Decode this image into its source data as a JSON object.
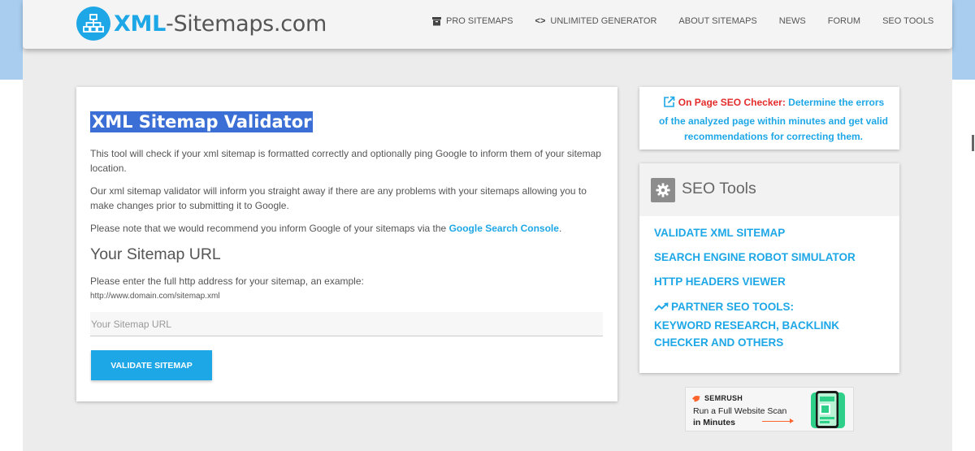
{
  "header": {
    "logo": {
      "bold": "XML",
      "rest": "-Sitemaps.com"
    },
    "nav": [
      {
        "label": "PRO SITEMAPS",
        "icon": "archive-icon"
      },
      {
        "label": "UNLIMITED GENERATOR",
        "icon": "code-icon"
      },
      {
        "label": "ABOUT SITEMAPS"
      },
      {
        "label": "NEWS"
      },
      {
        "label": "FORUM"
      },
      {
        "label": "SEO TOOLS"
      }
    ]
  },
  "main": {
    "title": "XML Sitemap Validator",
    "para1": "This tool will check if your xml sitemap is formatted correctly and optionally ping Google to inform them of your sitemap location.",
    "para2": "Our xml sitemap validator will inform you straight away if there are any problems with your sitemaps allowing you to make changes prior to submitting it to Google.",
    "para3_prefix": "Please note that we would recommend you inform Google of your sitemaps via the ",
    "para3_link": "Google Search Console",
    "para3_suffix": ".",
    "url_heading": "Your Sitemap URL",
    "hint": "Please enter the full http address for your sitemap, an example:",
    "example": "http://www.domain.com/sitemap.xml",
    "input_placeholder": "Your Sitemap URL",
    "input_value": "",
    "button_label": "VALIDATE SITEMAP"
  },
  "checker": {
    "label": "On Page SEO Checker:",
    "text": "Determine the errors of the analyzed page within minutes and get valid recommendations for correcting them."
  },
  "seo_tools": {
    "title": "SEO Tools",
    "links": [
      {
        "label": "VALIDATE XML SITEMAP"
      },
      {
        "label": "SEARCH ENGINE ROBOT SIMULATOR"
      },
      {
        "label": "HTTP HEADERS VIEWER"
      },
      {
        "label_line1": "PARTNER SEO TOOLS:",
        "label_line2": "KEYWORD RESEARCH, BACKLINK",
        "label_line3": "CHECKER AND OTHERS"
      }
    ]
  },
  "ad": {
    "brand": "SEMRUSH",
    "line1": "Run a Full Website Scan",
    "line2": "in Minutes"
  },
  "colors": {
    "accent": "#1ea7e6",
    "title_highlight": "#3b6fd6",
    "checker_label": "#e32b2b",
    "ad_accent": "#ff642d"
  }
}
